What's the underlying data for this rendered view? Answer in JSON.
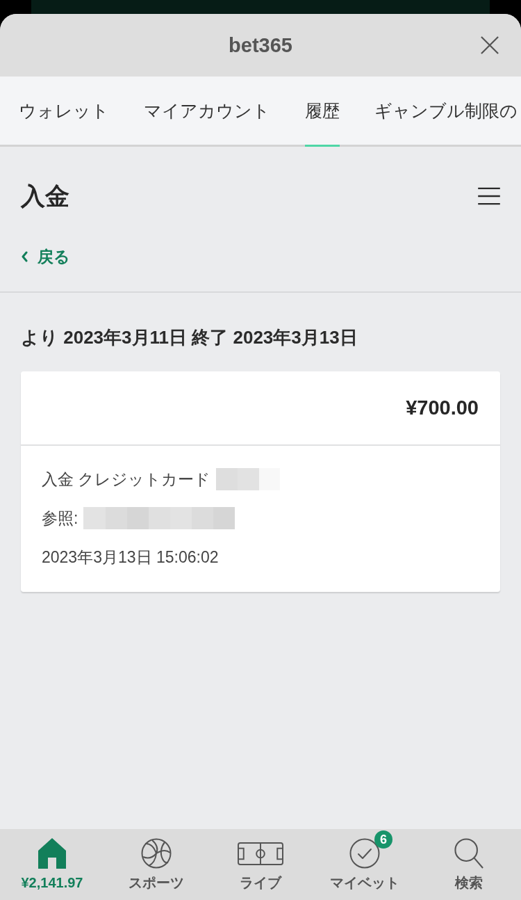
{
  "window": {
    "title": "bet365"
  },
  "tabs": [
    {
      "label": "ウォレット",
      "selected": false
    },
    {
      "label": "マイアカウント",
      "selected": false
    },
    {
      "label": "履歴",
      "selected": true
    },
    {
      "label": "ギャンブル制限の",
      "selected": false
    }
  ],
  "page": {
    "title": "入金",
    "back_link": "戻る"
  },
  "date_range": "より 2023年3月11日 終了 2023年3月13日",
  "transactions": [
    {
      "amount": "¥700.00",
      "details": [
        {
          "text": "入金 クレジットカード",
          "redacted": true
        },
        {
          "text": "参照:",
          "redacted": true
        },
        {
          "text": "2023年3月13日 15:06:02",
          "redacted": false
        }
      ]
    }
  ],
  "bottom_nav": [
    {
      "kind": "home",
      "label": "¥2,141.97",
      "selected": true
    },
    {
      "kind": "sports",
      "label": "スポーツ",
      "selected": false
    },
    {
      "kind": "live",
      "label": "ライブ",
      "selected": false
    },
    {
      "kind": "mybets",
      "label": "マイベット",
      "selected": false,
      "badge": "6"
    },
    {
      "kind": "search",
      "label": "検索",
      "selected": false
    }
  ]
}
